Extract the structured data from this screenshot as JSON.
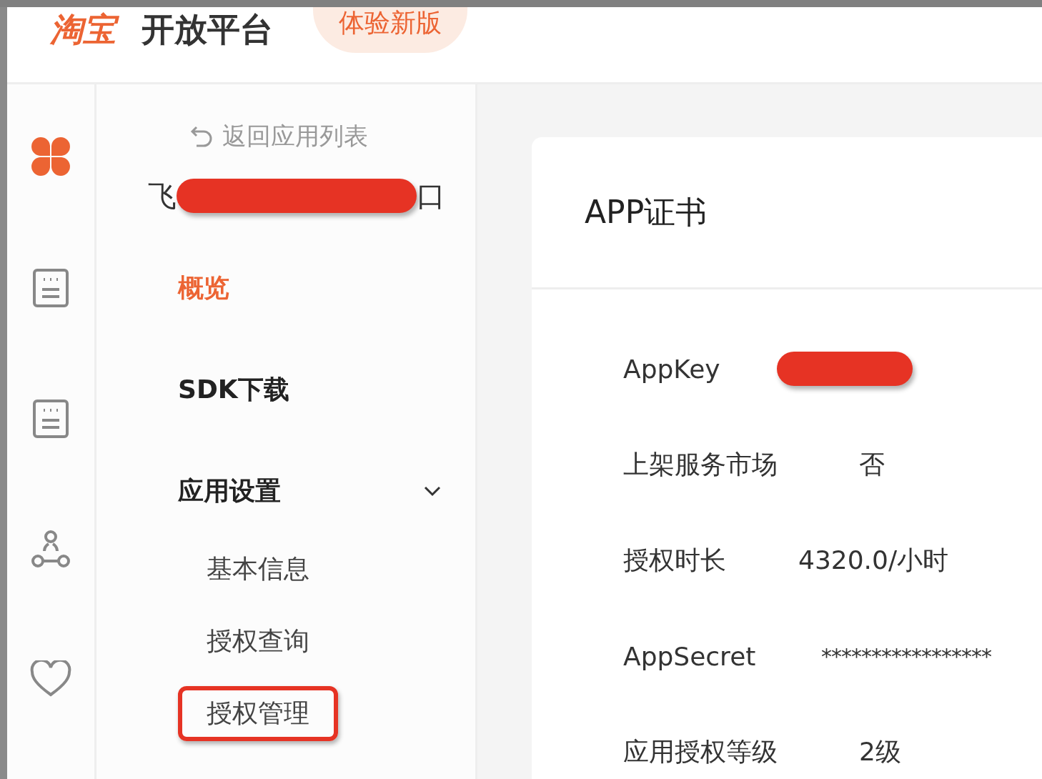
{
  "header": {
    "logo": "淘宝",
    "title": "开放平台",
    "try_button": "体验新版"
  },
  "rail": [
    {
      "kind": "clover",
      "selected": true
    },
    {
      "kind": "document",
      "selected": false
    },
    {
      "kind": "document",
      "selected": false
    },
    {
      "kind": "people",
      "selected": false
    },
    {
      "kind": "heart",
      "selected": false
    }
  ],
  "nav": {
    "back_link": "返回应用列表",
    "app_name": {
      "prefix": "飞",
      "suffix": "口",
      "redacted": true
    },
    "items": [
      {
        "label": "概览",
        "selected": true
      },
      {
        "label": "SDK下载",
        "selected": false
      },
      {
        "label": "应用设置",
        "selected": false,
        "expanded": true,
        "children": [
          {
            "label": "基本信息",
            "selected": false,
            "highlighted": false
          },
          {
            "label": "授权查询",
            "selected": false,
            "highlighted": false
          },
          {
            "label": "授权管理",
            "selected": false,
            "highlighted": true
          }
        ]
      }
    ]
  },
  "card": {
    "title": "APP证书",
    "rows": [
      {
        "label": "AppKey",
        "redacted": true
      },
      {
        "label": "上架服务市场",
        "value": "否"
      },
      {
        "label": "授权时长",
        "value": "4320.0/小时"
      },
      {
        "label": "AppSecret",
        "value": "*****************"
      },
      {
        "label": "应用授权等级",
        "value": "2级"
      }
    ]
  }
}
